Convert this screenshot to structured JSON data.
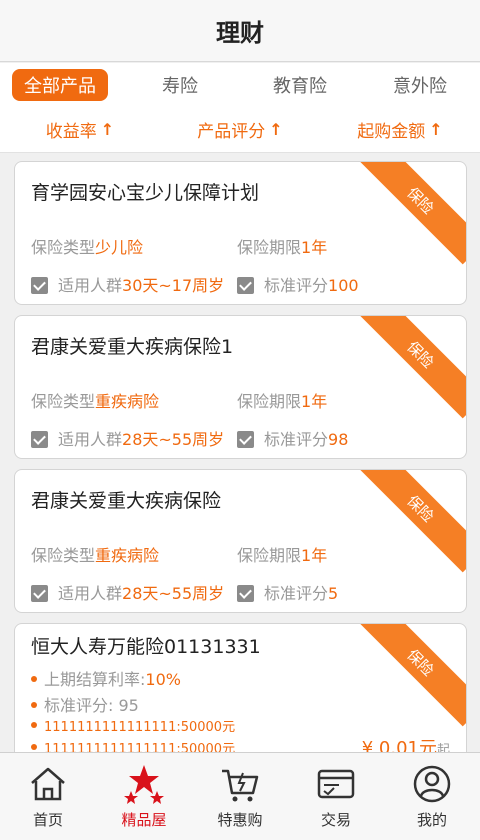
{
  "header": {
    "title": "理财"
  },
  "tabs": [
    "全部产品",
    "寿险",
    "教育险",
    "意外险"
  ],
  "sort": [
    "收益率",
    "产品评分",
    "起购金额"
  ],
  "ribbon_label": "保险",
  "labels": {
    "type": "保险类型",
    "period": "保险期限",
    "crowd": "适用人群",
    "score": "标准评分"
  },
  "cards": [
    {
      "name": "育学园安心宝少儿保障计划",
      "type": "少儿险",
      "period": "1年",
      "crowd": "30天~17周岁",
      "score": "100"
    },
    {
      "name": "君康关爱重大疾病保险1",
      "type": "重疾病险",
      "period": "1年",
      "crowd": "28天~55周岁",
      "score": "98"
    },
    {
      "name": "君康关爱重大疾病保险",
      "type": "重疾病险",
      "period": "1年",
      "crowd": "28天~55周岁",
      "score": "5"
    }
  ],
  "card4": {
    "name": "恒大人寿万能险01131331",
    "rate_label": "上期结算利率:",
    "rate_value": "10%",
    "score_label": "标准评分: 95",
    "item1": "1111111111111111:50000元",
    "item2": "1111111111111111:50000元",
    "price": "¥ 0.01元",
    "price_suffix": "起"
  },
  "nav": [
    {
      "label": "首页",
      "icon": "home-icon"
    },
    {
      "label": "精品屋",
      "icon": "stars-icon"
    },
    {
      "label": "特惠购",
      "icon": "cart-icon"
    },
    {
      "label": "交易",
      "icon": "card-icon"
    },
    {
      "label": "我的",
      "icon": "user-icon"
    }
  ],
  "colors": {
    "accent": "#f06a10",
    "ribbon": "#f57f25",
    "nav_active": "#d9121b"
  }
}
